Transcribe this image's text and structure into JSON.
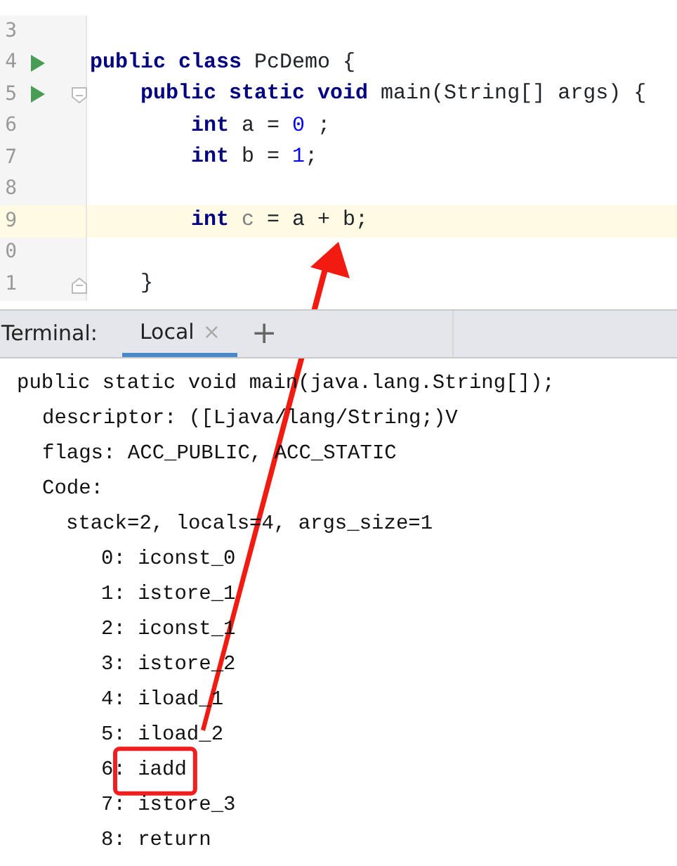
{
  "editor": {
    "lines": [
      {
        "number": "3",
        "run": false,
        "fold_open": false,
        "fold_close": false,
        "current": false
      },
      {
        "number": "4",
        "run": true,
        "fold_open": false,
        "fold_close": false,
        "current": false,
        "tokens": [
          {
            "text": "public class",
            "kind": "keyword"
          },
          {
            "text": " PcDemo {",
            "kind": "plain"
          }
        ]
      },
      {
        "number": "5",
        "run": true,
        "fold_open": true,
        "fold_close": false,
        "current": false,
        "tokens": [
          {
            "text": "    public static void",
            "kind": "keyword"
          },
          {
            "text": " main(String[] args) {",
            "kind": "plain"
          }
        ]
      },
      {
        "number": "6",
        "run": false,
        "fold_open": false,
        "fold_close": false,
        "current": false,
        "tokens": [
          {
            "text": "        int",
            "kind": "keyword"
          },
          {
            "text": " a = ",
            "kind": "plain"
          },
          {
            "text": "0",
            "kind": "number"
          },
          {
            "text": " ;",
            "kind": "plain"
          }
        ]
      },
      {
        "number": "7",
        "run": false,
        "fold_open": false,
        "fold_close": false,
        "current": false,
        "tokens": [
          {
            "text": "        int",
            "kind": "keyword"
          },
          {
            "text": " b = ",
            "kind": "plain"
          },
          {
            "text": "1",
            "kind": "number"
          },
          {
            "text": ";",
            "kind": "plain"
          }
        ]
      },
      {
        "number": "8",
        "run": false,
        "fold_open": false,
        "fold_close": false,
        "current": false
      },
      {
        "number": "9",
        "run": false,
        "fold_open": false,
        "fold_close": false,
        "current": true,
        "tokens": [
          {
            "text": "        int",
            "kind": "keyword"
          },
          {
            "text": " c",
            "kind": "unused"
          },
          {
            "text": " = a + b;",
            "kind": "plain"
          }
        ]
      },
      {
        "number": "0",
        "run": false,
        "fold_open": false,
        "fold_close": false,
        "current": false
      },
      {
        "number": "1",
        "run": false,
        "fold_open": false,
        "fold_close": true,
        "current": false,
        "tokens": [
          {
            "text": "    }",
            "kind": "plain"
          }
        ]
      }
    ]
  },
  "terminal": {
    "label": "Terminal:",
    "tabs": [
      {
        "label": "Local",
        "selected": true,
        "close": "×"
      }
    ],
    "add": "+",
    "lines": [
      {
        "text": "public static void main(java.lang.String[]);",
        "boxed": false,
        "children": [
          {
            "text": "descriptor: ([Ljava/lang/String;)V",
            "boxed": false
          },
          {
            "text": "flags: ACC_PUBLIC, ACC_STATIC",
            "boxed": false
          },
          {
            "text": "Code:",
            "boxed": false,
            "children": [
              {
                "text": "stack=2, locals=4, args_size=1",
                "boxed": false,
                "children": [
                  {
                    "text": "0: iconst_0",
                    "boxed": false
                  },
                  {
                    "text": "1: istore_1",
                    "boxed": false
                  },
                  {
                    "text": "2: iconst_1",
                    "boxed": false
                  },
                  {
                    "text": "3: istore_2",
                    "boxed": false
                  },
                  {
                    "text": "4: iload_1",
                    "boxed": false
                  },
                  {
                    "text": "5: iload_2",
                    "boxed": false
                  },
                  {
                    "text": "6: iadd",
                    "boxed": true
                  },
                  {
                    "text": "7: istore_3",
                    "boxed": false
                  },
                  {
                    "text": "8: return",
                    "boxed": false
                  }
                ]
              }
            ]
          }
        ]
      }
    ]
  },
  "arrow": true
}
